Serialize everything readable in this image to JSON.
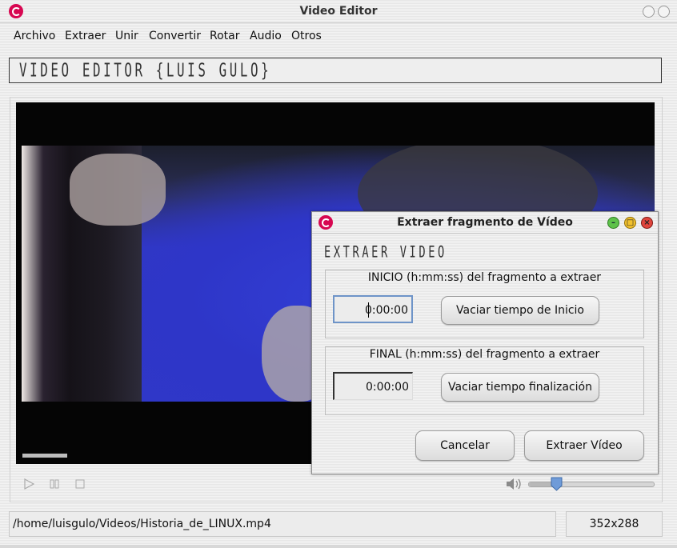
{
  "window": {
    "title": "Video Editor"
  },
  "menu": [
    "Archivo",
    "Extraer",
    "Unir",
    "Convertir",
    "Rotar",
    "Audio",
    "Otros"
  ],
  "banner": "VIDEO EDITOR {LUIS GULO}",
  "player": {
    "progress_fraction": 0.15,
    "volume_fraction": 0.23
  },
  "status": {
    "file_path": "/home/luisgulo/Videos/Historia_de_LINUX.mp4",
    "resolution": "352x288"
  },
  "dialog": {
    "title": "Extraer fragmento de Vídeo",
    "heading": "EXTRAER VIDEO",
    "start": {
      "legend": "INICIO (h:mm:ss) del fragmento a extraer",
      "value": "0:00:00",
      "clear_button": "Vaciar tiempo de Inicio"
    },
    "end": {
      "legend": "FINAL (h:mm:ss) del fragmento a extraer",
      "value": "0:00:00",
      "clear_button": "Vaciar tiempo finalización"
    },
    "cancel_button": "Cancelar",
    "extract_button": "Extraer Vídeo"
  }
}
